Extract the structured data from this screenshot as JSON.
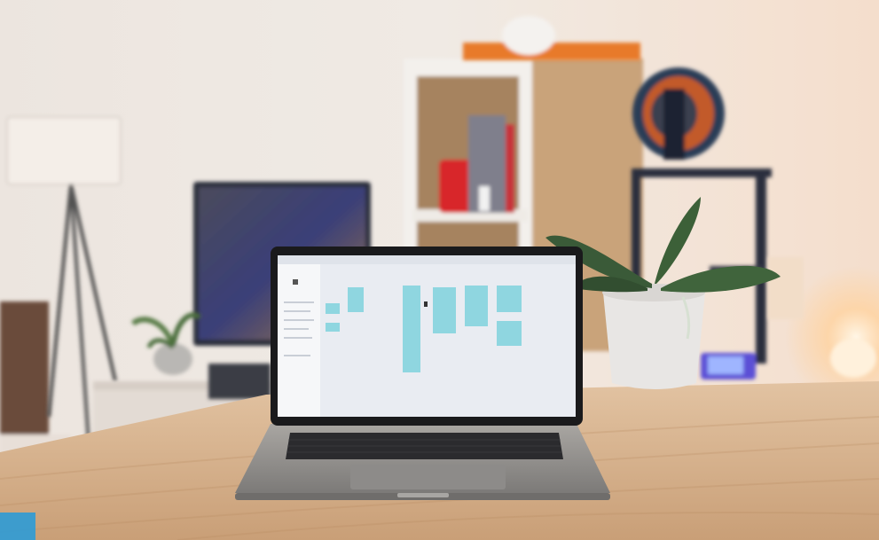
{
  "scene": {
    "subject": "laptop-on-wooden-desk",
    "objects": [
      "floor-lamp",
      "television",
      "bookshelf",
      "3d-printer",
      "filament-spool",
      "orchid-plant",
      "laptop",
      "small-plant",
      "glowing-lamp"
    ]
  },
  "colors": {
    "wall": "#ece4dc",
    "desk": "#d9b896",
    "laptop_body": "#9a9896",
    "screen_bg": "#e9ecf2",
    "screen_cards": "#8fd6e0",
    "shelf": "#c9a37a",
    "printer_frame": "#2b2f3c",
    "spool": "#2a3d57",
    "pot": "#e8e6e4",
    "leaf": "#3a5a38",
    "accent_orange": "#e87a2a",
    "red_object": "#d8262a",
    "glow": "#ffd9a8"
  }
}
